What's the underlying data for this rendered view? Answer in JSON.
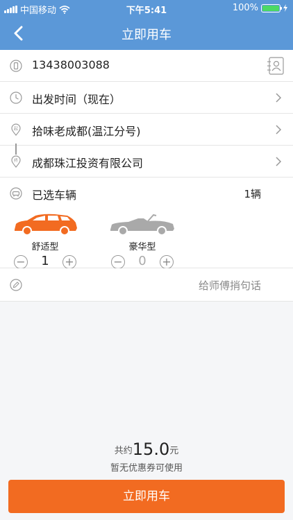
{
  "status_bar": {
    "carrier": "中国移动",
    "time": "下午5:41",
    "battery": "100%"
  },
  "header": {
    "title": "立即用车"
  },
  "form": {
    "phone": "13438003088",
    "depart_time": "出发时间（现在）",
    "origin": "拾味老成都(温江分号)",
    "destination": "成都珠江投资有限公司",
    "vehicles_label": "已选车辆",
    "vehicles_count": "1辆"
  },
  "vehicles": [
    {
      "name": "舒适型",
      "count": "1",
      "color": "#f26b21"
    },
    {
      "name": "豪华型",
      "count": "0",
      "color": "#a9a9a9"
    }
  ],
  "message": {
    "placeholder": "给师傅捎句话"
  },
  "summary": {
    "prefix": "共约",
    "price": "15.0",
    "unit": "元",
    "coupon": "暂无优惠券可使用"
  },
  "submit": {
    "label": "立即用车"
  },
  "colors": {
    "brand": "#5b98d8",
    "accent": "#f26b21"
  }
}
